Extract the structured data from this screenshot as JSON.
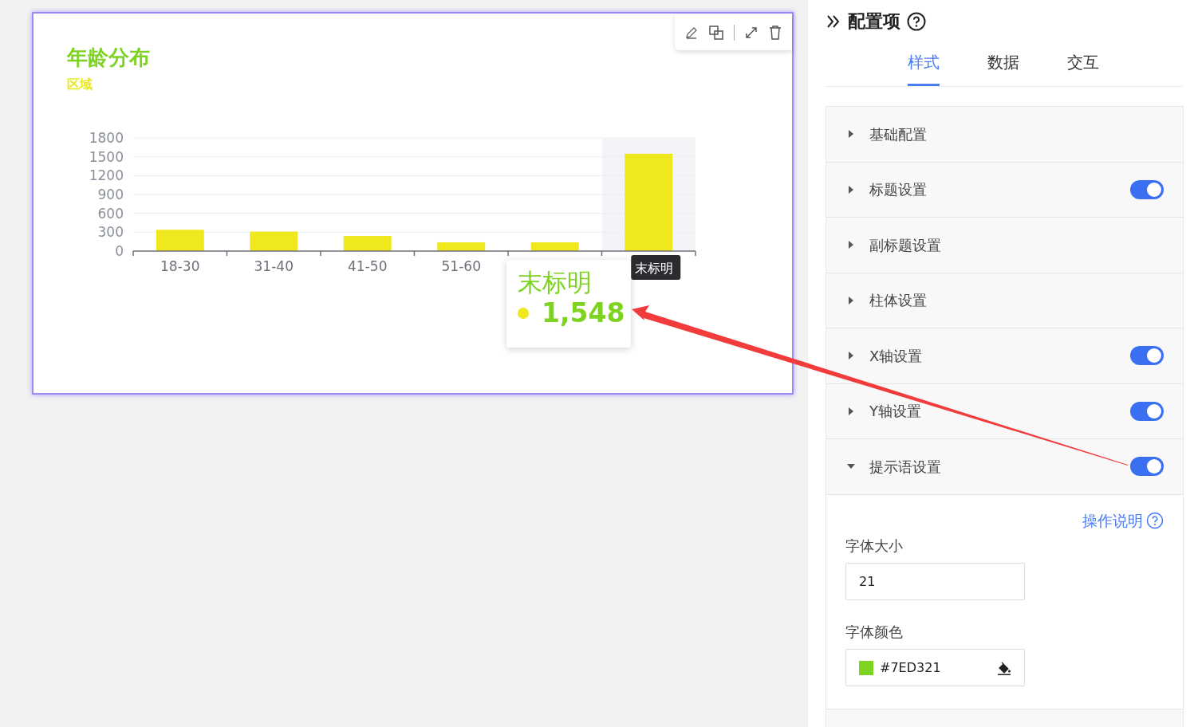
{
  "widget": {
    "title": "年龄分布",
    "subtitle": "区域",
    "chart_data": {
      "type": "bar",
      "categories": [
        "18-30",
        "31-40",
        "41-50",
        "51-60",
        null,
        "末标明"
      ],
      "series": [
        {
          "color": "#f0e81f",
          "values": [
            340,
            310,
            240,
            140,
            140,
            1548
          ]
        }
      ],
      "ylim": [
        0,
        1800
      ],
      "yticks": [
        0,
        300,
        600,
        900,
        1200,
        1500,
        1800
      ],
      "grid": true
    },
    "tooltip": {
      "title": "末标明",
      "value": "1,548",
      "color": "#f0e81f"
    }
  },
  "panel": {
    "title": "配置项",
    "tabs": [
      {
        "label": "样式",
        "selected": true
      },
      {
        "label": "数据",
        "selected": false
      },
      {
        "label": "交互",
        "selected": false
      }
    ],
    "sections": [
      {
        "label": "基础配置",
        "kind": "plain",
        "expanded": false
      },
      {
        "label": "标题设置",
        "kind": "toggle",
        "on": true,
        "expanded": false
      },
      {
        "label": "副标题设置",
        "kind": "plain",
        "expanded": false
      },
      {
        "label": "柱体设置",
        "kind": "plain",
        "expanded": false
      },
      {
        "label": "X轴设置",
        "kind": "toggle",
        "on": true,
        "expanded": false
      },
      {
        "label": "Y轴设置",
        "kind": "toggle",
        "on": true,
        "expanded": false
      },
      {
        "label": "提示语设置",
        "kind": "toggle",
        "on": true,
        "expanded": true,
        "help_link": "操作说明",
        "fields": [
          {
            "label": "字体大小",
            "kind": "number",
            "value": "21"
          },
          {
            "label": "字体颜色",
            "kind": "color",
            "value": "#7ED321",
            "color": "#7ed321"
          }
        ]
      }
    ]
  }
}
